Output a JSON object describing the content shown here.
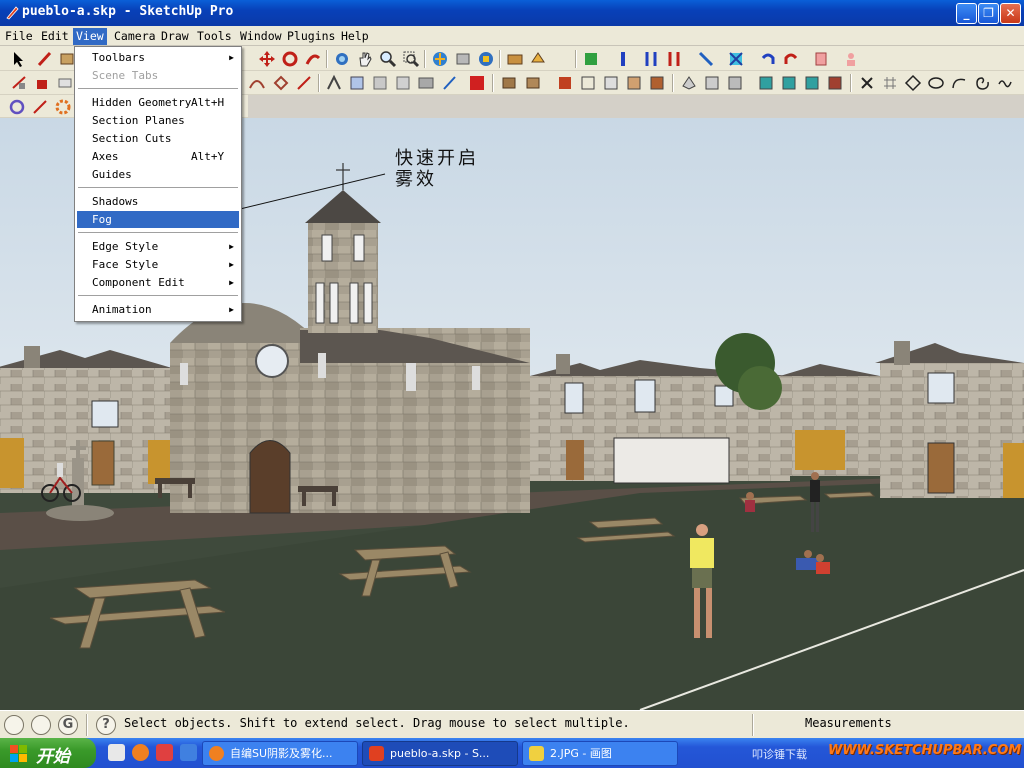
{
  "window": {
    "title": "pueblo-a.skp - SketchUp Pro",
    "minimize_glyph": "_",
    "maximize_glyph": "❐",
    "close_glyph": "✕"
  },
  "menubar": [
    {
      "label": "File"
    },
    {
      "label": "Edit"
    },
    {
      "label": "View"
    },
    {
      "label": "Camera"
    },
    {
      "label": "Draw"
    },
    {
      "label": "Tools"
    },
    {
      "label": "Window"
    },
    {
      "label": "Plugins"
    },
    {
      "label": "Help"
    }
  ],
  "view_menu": {
    "toolbars": "Toolbars",
    "scene_tabs": "Scene Tabs",
    "hidden_geometry": "Hidden Geometry",
    "hidden_geometry_shortcut": "Alt+H",
    "section_planes": "Section Planes",
    "section_cuts": "Section Cuts",
    "axes": "Axes",
    "axes_shortcut": "Alt+Y",
    "guides": "Guides",
    "shadows": "Shadows",
    "fog": "Fog",
    "edge_style": "Edge Style",
    "face_style": "Face Style",
    "component_edit": "Component Edit",
    "animation": "Animation"
  },
  "annotation": {
    "line1": "快速开启",
    "line2": "雾效"
  },
  "statusbar": {
    "message": "Select objects. Shift to extend select. Drag mouse to select multiple.",
    "measurements_label": "Measurements",
    "help_glyph": "?",
    "geo_glyph": "G"
  },
  "taskbar": {
    "start_label": "开始",
    "tasks": [
      {
        "label": "自编SU阴影及雾化..."
      },
      {
        "label": "pueblo-a.skp - S..."
      },
      {
        "label": "2.JPG - 画图"
      }
    ],
    "tray_text": "叩诊锤下载",
    "watermark": "WWW.SKETCHUPBAR.COM"
  }
}
